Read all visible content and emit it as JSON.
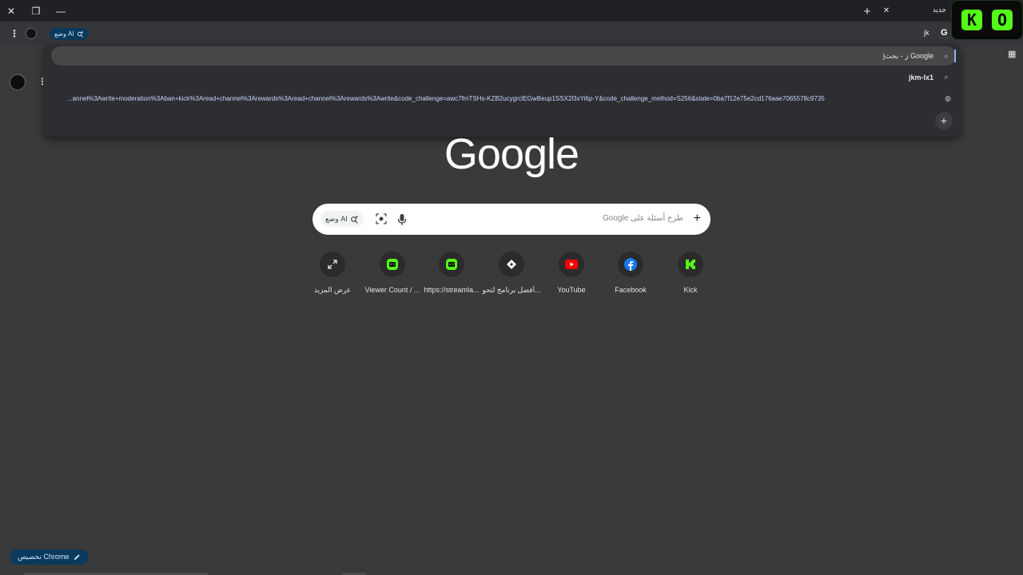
{
  "window": {
    "tab_title_partial": "جديدة",
    "close_glyph": "✕",
    "restore_glyph": "❐",
    "minimize_glyph": "—",
    "new_tab_glyph": "+",
    "tab_close_glyph": "✕"
  },
  "toolbar": {
    "ai_mode_chip": "وضع AI",
    "extension_label": "jk",
    "g_badge": "G"
  },
  "overlay": {
    "letter1": "K",
    "letter2": "O"
  },
  "omnibox": {
    "suggestions": [
      {
        "text": "jز - بحث Google",
        "icon": "search-icon"
      },
      {
        "text": "jkm-lx1",
        "icon": "search-icon"
      }
    ],
    "url_suggestion": "...annel%3Awrite+moderation%3Aban+kick%3Aread+channel%3Arewards%3Aread+channel%3Arewards%3Awrite&code_challenge=awc7fmTSHs-KZB2ucygrclEGwBeup1SSX2l3xYi6p-Y&code_challenge_method=S256&state=0ba7f12e75e2cd176aae7065578c9735",
    "add_glyph": "+"
  },
  "google_logo": "Google",
  "searchbox": {
    "placeholder": "طرح أسئلة على Google",
    "ai_mode_label": "وضع AI"
  },
  "shortcuts": [
    {
      "label": "عرض المزيد",
      "icon": "expand-icon"
    },
    {
      "label": "Viewer Count / ...",
      "icon": "kick-bot-icon"
    },
    {
      "label": "https://streamla...",
      "icon": "kick-bot-icon"
    },
    {
      "label": "أفضل برنامج لتحو...",
      "icon": "streamlabs-icon"
    },
    {
      "label": "YouTube",
      "icon": "youtube-icon"
    },
    {
      "label": "Facebook",
      "icon": "facebook-icon"
    },
    {
      "label": "Kick",
      "icon": "kick-icon"
    }
  ],
  "customize": {
    "label": "تخصيص Chrome"
  },
  "colors": {
    "page_bg": "#3a3a3a",
    "accent_blue": "#8ab4f8",
    "kick_green": "#53fc18",
    "youtube_red": "#ff0000",
    "facebook_blue": "#1877f2"
  }
}
